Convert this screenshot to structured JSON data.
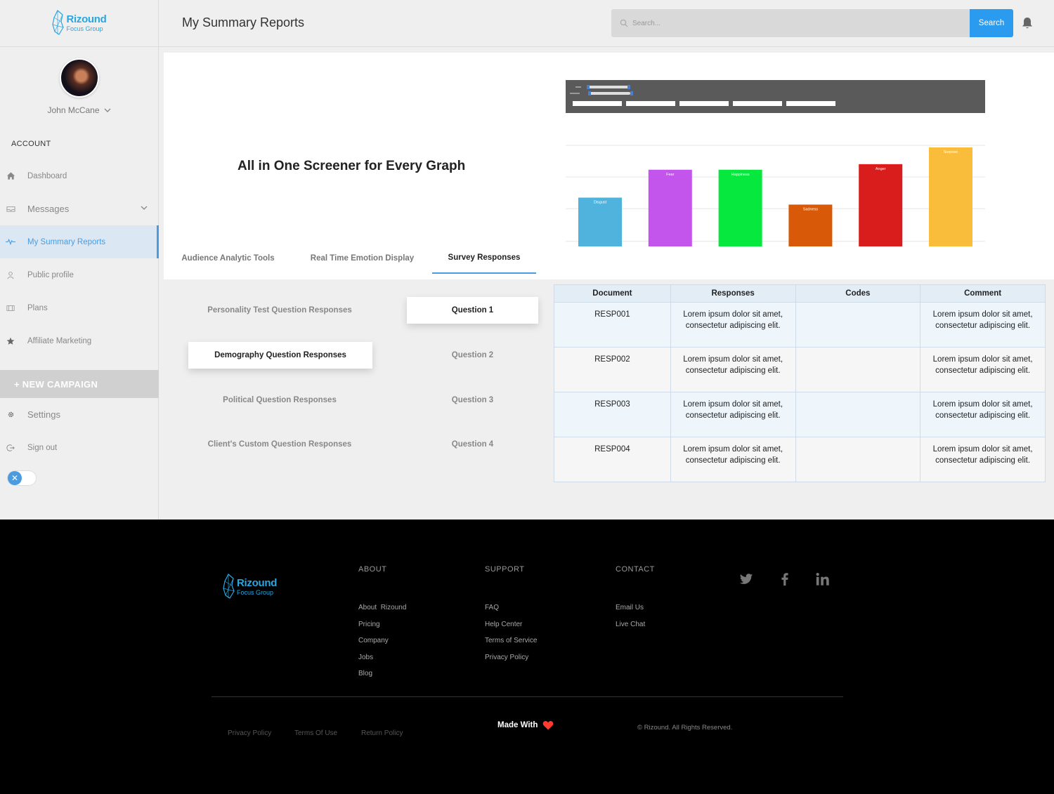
{
  "brand": {
    "name": "Rizound",
    "sub": "Focus Group"
  },
  "sidebar": {
    "username": "John McCane",
    "account_label": "ACCOUNT",
    "items": [
      {
        "label": "Dashboard",
        "icon": "home-icon"
      },
      {
        "label": "Messages",
        "icon": "inbox-icon"
      },
      {
        "label": "My Summary Reports",
        "icon": "pulse-icon",
        "active": true
      },
      {
        "label": "Public profile",
        "icon": "user-icon"
      },
      {
        "label": "Plans",
        "icon": "wallet-icon"
      },
      {
        "label": "Affiliate Marketing",
        "icon": "star-icon"
      }
    ],
    "new_campaign": "+ NEW CAMPAIGN",
    "settings": "Settings",
    "signout": "Sign out",
    "toggle_symbol": "✕"
  },
  "header": {
    "title": "My Summary Reports",
    "search_placeholder": "Search...",
    "search_button": "Search"
  },
  "hero": {
    "title": "All in One Screener for Every Graph",
    "tabs": [
      "Audience Analytic Tools",
      "Real Time Emotion Display",
      "Survey Responses"
    ],
    "active_tab": 2
  },
  "chart_data": {
    "type": "bar",
    "categories": [
      "Disgust",
      "Fear",
      "Happiness",
      "Sadness",
      "Anger",
      "Surprise"
    ],
    "values": [
      70,
      110,
      110,
      60,
      118,
      142
    ],
    "colors": [
      "#4fb3de",
      "#c455ec",
      "#07e83f",
      "#d85a08",
      "#d91c1c",
      "#f9bd3b"
    ],
    "ylim": [
      0,
      145
    ],
    "grid": true,
    "title": "",
    "xlabel": "",
    "ylabel": ""
  },
  "questions": {
    "categories": [
      "Personality Test Question Responses",
      "Demography Question Responses",
      "Political Question Responses",
      "Client's Custom Question Responses"
    ],
    "selected_category": 1,
    "items": [
      "Question 1",
      "Question 2",
      "Question 3",
      "Question 4"
    ],
    "selected_item": 0
  },
  "table": {
    "headers": [
      "Document",
      "Responses",
      "Codes",
      "Comment"
    ],
    "rows": [
      {
        "doc": "RESP001",
        "response": "Lorem ipsum dolor sit amet, consectetur adipiscing elit.",
        "codes": "",
        "comment": "Lorem ipsum dolor sit amet, consectetur adipiscing elit."
      },
      {
        "doc": "RESP002",
        "response": "Lorem ipsum dolor sit amet, consectetur adipiscing elit.",
        "codes": "",
        "comment": "Lorem ipsum dolor sit amet, consectetur adipiscing elit."
      },
      {
        "doc": "RESP003",
        "response": "Lorem ipsum dolor sit amet, consectetur adipiscing elit.",
        "codes": "",
        "comment": "Lorem ipsum dolor sit amet, consectetur adipiscing elit."
      },
      {
        "doc": "RESP004",
        "response": "Lorem ipsum dolor sit amet, consectetur adipiscing elit.",
        "codes": "",
        "comment": "Lorem ipsum dolor sit amet, consectetur adipiscing elit."
      }
    ]
  },
  "footer": {
    "about": {
      "title": "ABOUT",
      "items": [
        "About  Rizound",
        "Pricing",
        "Company",
        "Jobs",
        "Blog"
      ]
    },
    "support": {
      "title": "SUPPORT",
      "items": [
        "FAQ",
        "Help Center",
        "Terms of Service",
        "Privacy Policy"
      ]
    },
    "contact": {
      "title": "CONTACT",
      "items": [
        "Email Us",
        "Live Chat"
      ]
    },
    "bottom_links": [
      "Privacy Policy",
      "Terms Of Use",
      "Return Policy"
    ],
    "made_with": "Made With",
    "copyright": "© Rizound. All Rights Reserved."
  },
  "colors": {
    "accent": "#2b9bf0",
    "active_nav": "#4a9be0",
    "heart": "#ff3b2f"
  }
}
